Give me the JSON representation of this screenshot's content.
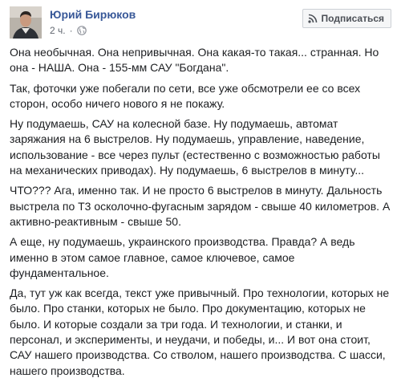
{
  "author": {
    "name": "Юрий Бирюков",
    "timestamp": "2 ч.",
    "separator": "·",
    "privacy_icon": "globe-icon"
  },
  "header": {
    "subscribe_label": "Подписаться",
    "subscribe_icon": "rss-icon"
  },
  "post": {
    "paragraphs": [
      "Она необычная. Она непривычная. Она какая-то такая... странная. Но она - НАША. Она - 155-мм САУ \"Богдана\".",
      "Так, фоточки уже побегали по сети, все уже обсмотрели ее со всех сторон, особо ничего нового я не покажу.",
      "Ну подумаешь, САУ на колесной базе. Ну подумаешь, автомат заряжания на 6 выстрелов. Ну подумаешь, управление, наведение, использование - все через пульт (естественно с возможностью работы на механических приводах). Ну подумаешь, 6 выстрелов в минуту...",
      "ЧТО??? Ага, именно так. И не просто 6 выстрелов в минуту. Дальность выстрела по Т3 осколочно-фугасным зарядом - свыше 40 километров. А активно-реактивным - свыше 50.",
      "А еще, ну подумаешь, украинского производства. Правда? А ведь именно в этом самое главное, самое ключевое, самое фундаментальное.",
      "Да, тут уж как всегда, текст уже привычный. Про технологии, которых не было. Про станки, которых не было. Про документацию, которых не было. И которые создали за три года. И технологии, и станки, и персонал, и эксперименты, и неудачи, и победы, и... И вот она стоит, САУ нашего производства. Со стволом, нашего производства. С шасси, нашего производства."
    ]
  },
  "colors": {
    "author_link": "#385898",
    "meta_text": "#616770",
    "body_text": "#1c1e21",
    "button_bg": "#f5f6f7"
  }
}
